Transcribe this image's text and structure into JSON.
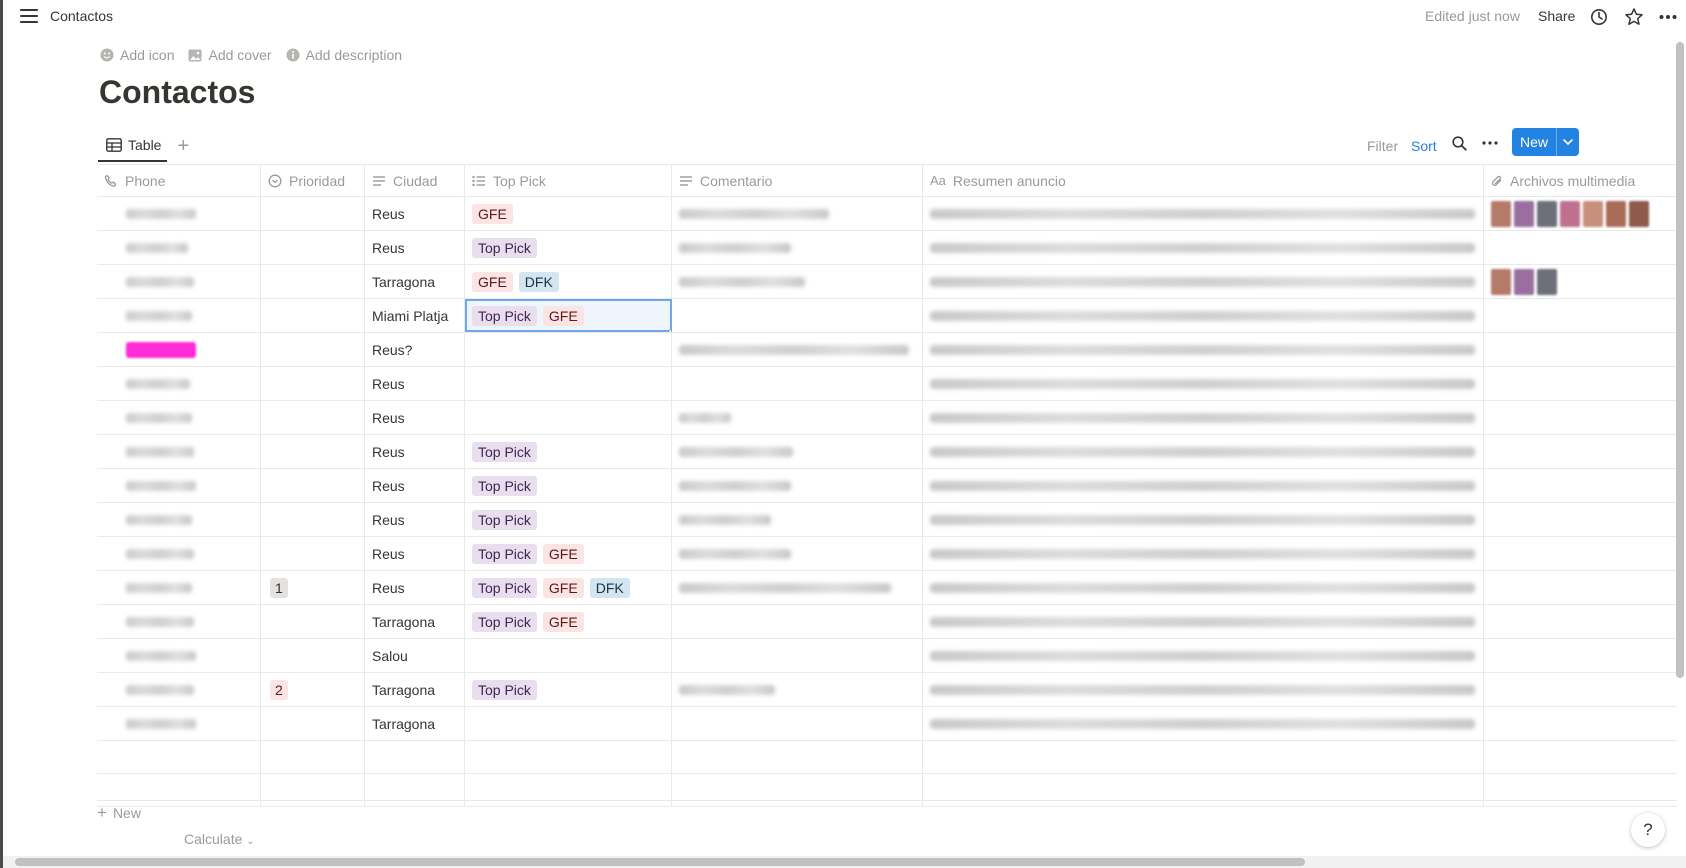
{
  "topbar": {
    "breadcrumb": "Contactos",
    "edited": "Edited just now",
    "share": "Share"
  },
  "page": {
    "add_icon": "Add icon",
    "add_cover": "Add cover",
    "add_description": "Add description",
    "title": "Contactos"
  },
  "view": {
    "tab_label": "Table",
    "filter": "Filter",
    "sort": "Sort",
    "new": "New"
  },
  "columns": [
    {
      "label": "Phone",
      "icon": "phone-icon"
    },
    {
      "label": "Prioridad",
      "icon": "status-icon"
    },
    {
      "label": "Ciudad",
      "icon": "text-icon"
    },
    {
      "label": "Top Pick",
      "icon": "multi-select-icon"
    },
    {
      "label": "Comentario",
      "icon": "text-icon"
    },
    {
      "label": "Resumen anuncio",
      "icon": "title-icon"
    },
    {
      "label": "Archivos multimedia",
      "icon": "paperclip-icon"
    }
  ],
  "rows": [
    {
      "prio": "",
      "ciudad": "Reus",
      "tags": [
        "GFE"
      ],
      "comment": true,
      "media": 7
    },
    {
      "prio": "",
      "ciudad": "Reus",
      "tags": [
        "Top Pick"
      ],
      "comment": true,
      "media": 0
    },
    {
      "prio": "",
      "ciudad": "Tarragona",
      "tags": [
        "GFE",
        "DFK"
      ],
      "comment": true,
      "media": 3
    },
    {
      "prio": "",
      "ciudad": "Miami Platja",
      "tags": [
        "Top Pick",
        "GFE"
      ],
      "comment": false,
      "media": 0,
      "selected": true
    },
    {
      "prio": "",
      "ciudad": "Reus?",
      "tags": [],
      "comment": true,
      "media": 0,
      "pink": true
    },
    {
      "prio": "",
      "ciudad": "Reus",
      "tags": [],
      "comment": false,
      "media": 0
    },
    {
      "prio": "",
      "ciudad": "Reus",
      "tags": [],
      "comment": true,
      "media": 0
    },
    {
      "prio": "",
      "ciudad": "Reus",
      "tags": [
        "Top Pick"
      ],
      "comment": true,
      "media": 0
    },
    {
      "prio": "",
      "ciudad": "Reus",
      "tags": [
        "Top Pick"
      ],
      "comment": true,
      "media": 0
    },
    {
      "prio": "",
      "ciudad": "Reus",
      "tags": [
        "Top Pick"
      ],
      "comment": true,
      "media": 0
    },
    {
      "prio": "",
      "ciudad": "Reus",
      "tags": [
        "Top Pick",
        "GFE"
      ],
      "comment": true,
      "media": 0
    },
    {
      "prio": "1",
      "ciudad": "Reus",
      "tags": [
        "Top Pick",
        "GFE",
        "DFK"
      ],
      "comment": true,
      "media": 0
    },
    {
      "prio": "",
      "ciudad": "Tarragona",
      "tags": [
        "Top Pick",
        "GFE"
      ],
      "comment": false,
      "media": 0
    },
    {
      "prio": "",
      "ciudad": "Salou",
      "tags": [],
      "comment": false,
      "media": 0
    },
    {
      "prio": "2",
      "ciudad": "Tarragona",
      "tags": [
        "Top Pick"
      ],
      "comment": true,
      "media": 0
    },
    {
      "prio": "",
      "ciudad": "Tarragona",
      "tags": [],
      "comment": false,
      "media": 0
    }
  ],
  "footer": {
    "new_row": "New",
    "calculate": "Calculate",
    "help": "?"
  }
}
